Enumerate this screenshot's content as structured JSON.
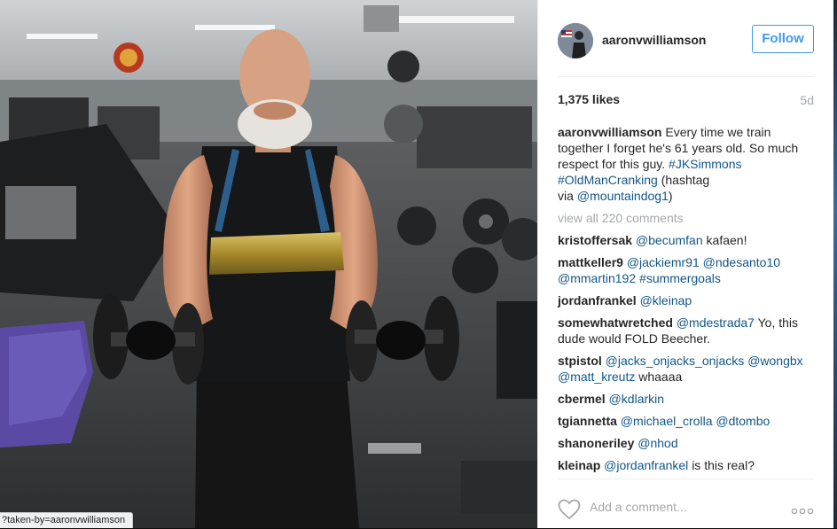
{
  "post": {
    "username": "aaronvwilliamson",
    "follow_label": "Follow",
    "likes": "1,375 likes",
    "time": "5d",
    "caption": {
      "user": "aaronvwilliamson",
      "text_1": "Every time we train together I forget he's 61 years old. So much respect for this guy.",
      "tag_1": "#JKSimmons",
      "tag_2": "#OldManCranking",
      "text_2": "(hashtag via",
      "mention": "@mountaindog1",
      "text_3": ")"
    },
    "view_all": "view all 220 comments",
    "comments": [
      {
        "user": "kristoffersak",
        "m1": "@becumfan",
        "text": "kafaen!"
      },
      {
        "user": "mattkeller9",
        "m1": "@jackiemr91",
        "m2": "@ndesanto10",
        "m3": "@mmartin192",
        "tag": "#summergoals"
      },
      {
        "user": "jordanfrankel",
        "m1": "@kleinap"
      },
      {
        "user": "somewhatwretched",
        "m1": "@mdestrada7",
        "text": "Yo, this dude would FOLD Beecher."
      },
      {
        "user": "stpistol",
        "m1": "@jacks_onjacks_onjacks",
        "m2": "@wongbx",
        "m3": "@matt_kreutz",
        "text": "whaaaa"
      },
      {
        "user": "cbermel",
        "m1": "@kdlarkin"
      },
      {
        "user": "tgiannetta",
        "m1": "@michael_crolla",
        "m2": "@dtombo"
      },
      {
        "user": "shanoneriley",
        "m1": "@nhod"
      },
      {
        "user": "kleinap",
        "m1": "@jordanfrankel",
        "text": "is this real?"
      }
    ],
    "add_comment_placeholder": "Add a comment...",
    "status_url": "?taken-by=aaronvwilliamson"
  },
  "icons": {
    "like": "heart-outline-icon",
    "more": "more-options-icon"
  },
  "colors": {
    "link": "#125688",
    "follow": "#3f99ed",
    "muted": "#a5a7aa",
    "text": "#262626"
  }
}
